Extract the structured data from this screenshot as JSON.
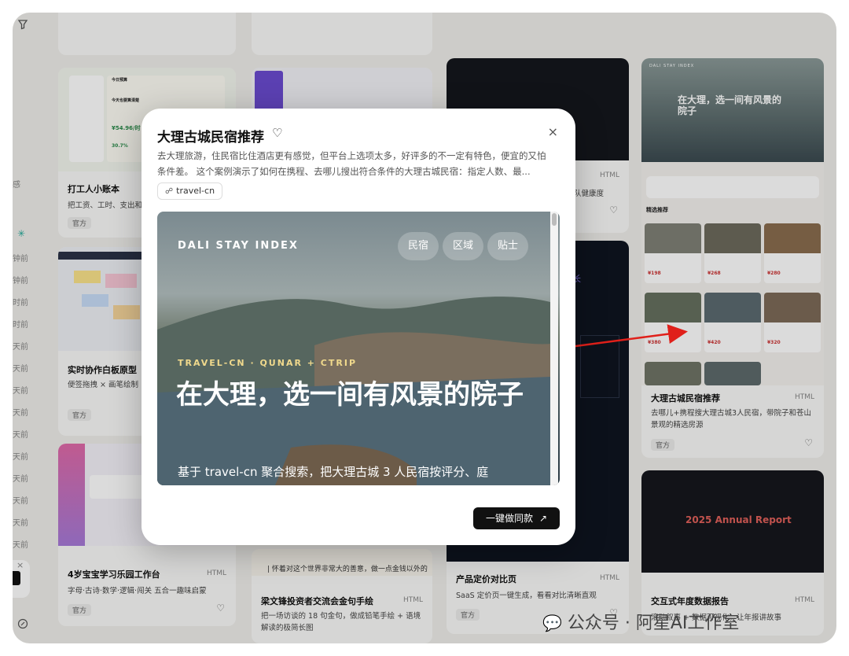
{
  "rail": {
    "items": [
      "感",
      "钟前",
      "钟前",
      "时前",
      "时前",
      "天前",
      "天前",
      "天前",
      "天前",
      "天前",
      "天前",
      "天前",
      "天前",
      "天前",
      "天前"
    ]
  },
  "cards": {
    "ledger": {
      "title": "打工人小账本",
      "desc": "把工资、工时、支出和",
      "badge": "官方",
      "thumb_texts": [
        "今日预算",
        "今天也要算清楚",
        "¥54.96/时",
        "30.7%"
      ]
    },
    "whiteboard": {
      "title": "实时协作白板原型",
      "desc": "便签拖拽 × 画笔绘制 × 白板一键生成",
      "badge": "官方"
    },
    "baby": {
      "title": "4岁宝宝学习乐园工作台",
      "tag": "HTML",
      "desc": "字母·古诗·数学·逻辑·闯关 五合一趣味启蒙",
      "badge": "官方"
    },
    "notes": {
      "title": "梁文锋投资者交流会金句手绘",
      "tag": "HTML",
      "desc": "把一场访谈的 18 句金句，做成铅笔手绘 + 语境解读的极简长图",
      "quote": "| 怀着对这个世界非常大的善意，做一点金钱以外的"
    },
    "health": {
      "tag": "HTML",
      "desc": "队健康度"
    },
    "pricing": {
      "title": "产品定价对比页",
      "tag": "HTML",
      "desc": "SaaS 定价页一键生成，看看对比清晰直观",
      "badge": "官方",
      "thumb_text": "长"
    },
    "dali": {
      "title": "大理古城民宿推荐",
      "tag": "HTML",
      "desc": "去哪儿+携程搜大理古城3人民宿，带院子和苍山景观的精选房源",
      "badge": "官方",
      "thumb_hero": "在大理，选一间有风景的院子",
      "thumb_brand": "DALI STAY INDEX",
      "section": "精选推荐",
      "prices": [
        "¥198",
        "¥268",
        "¥280",
        "¥380",
        "¥420",
        "¥320"
      ]
    },
    "report": {
      "title": "交互式年度数据报告",
      "tag": "HTML",
      "desc": "滚动叙事 + 数据可视化，让年报讲故事",
      "thumb_title": "2025 Annual Report"
    }
  },
  "modal": {
    "title": "大理古城民宿推荐",
    "intro": "去大理旅游，住民宿比住酒店更有感觉，但平台上选项太多，好评多的不一定有特色，便宜的又怕条件差。 这个案例演示了如何在携程、去哪儿搜出符合条件的大理古城民宿：指定人数、最...",
    "chip": "travel-cn",
    "preview": {
      "brand": "DALI STAY INDEX",
      "nav": [
        "民宿",
        "区域",
        "贴士"
      ],
      "kicker": "TRAVEL-CN · QUNAR + CTRIP",
      "headline": "在大理，选一间有风景的院子",
      "sub": "基于 travel-cn 聚合搜索，把大理古城 3 人民宿按评分、庭"
    },
    "cta": "一键做同款"
  },
  "watermark": "公众号 · 阿星AI工作室",
  "colors": {
    "accent_red": "#e0201a",
    "cta_bg": "#111111"
  }
}
